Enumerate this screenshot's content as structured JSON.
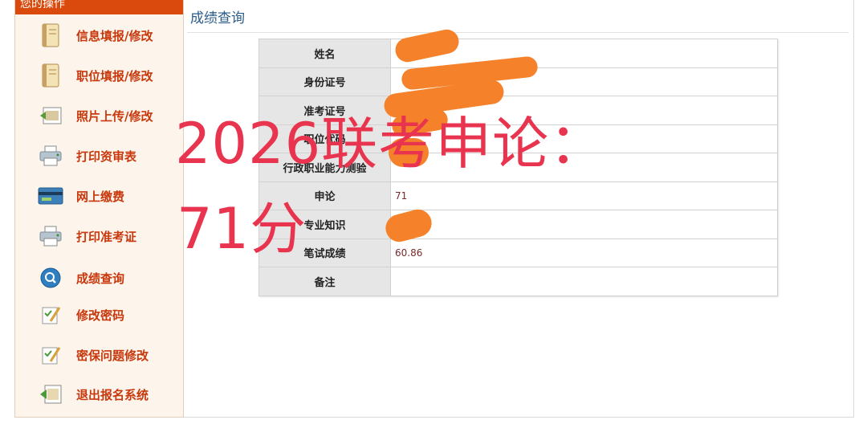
{
  "sidebar": {
    "header": "您的操作",
    "items": [
      {
        "label": "信息填报/修改",
        "icon": "notebook-icon"
      },
      {
        "label": "职位填报/修改",
        "icon": "notebook-icon"
      },
      {
        "label": "照片上传/修改",
        "icon": "photo-upload-icon"
      },
      {
        "label": "打印资审表",
        "icon": "printer-icon"
      },
      {
        "label": "网上缴费",
        "icon": "payment-card-icon"
      },
      {
        "label": "打印准考证",
        "icon": "printer-icon"
      },
      {
        "label": "成绩查询",
        "icon": "magnifier-icon"
      },
      {
        "label": "修改密码",
        "icon": "edit-checklist-icon"
      },
      {
        "label": "密保问题修改",
        "icon": "edit-checklist-icon"
      },
      {
        "label": "退出报名系统",
        "icon": "logout-icon"
      }
    ]
  },
  "main": {
    "title": "成绩查询",
    "rows": [
      {
        "label": "姓名",
        "value": ""
      },
      {
        "label": "身份证号",
        "value": ""
      },
      {
        "label": "准考证号",
        "value": ""
      },
      {
        "label": "职位代码",
        "value": ""
      },
      {
        "label": "行政职业能力测验",
        "value": ""
      },
      {
        "label": "申论",
        "value": "71"
      },
      {
        "label": "专业知识",
        "value": ""
      },
      {
        "label": "笔试成绩",
        "value": "60.86"
      },
      {
        "label": "备注",
        "value": ""
      }
    ]
  },
  "overlay": {
    "line1": "2026联考申论：",
    "line2": "71分",
    "color": "#e8344e"
  },
  "colors": {
    "sidebar_header": "#d94a0c",
    "menu_text": "#c8380c",
    "title_text": "#2a5c8a",
    "redaction": "#f5822a"
  }
}
